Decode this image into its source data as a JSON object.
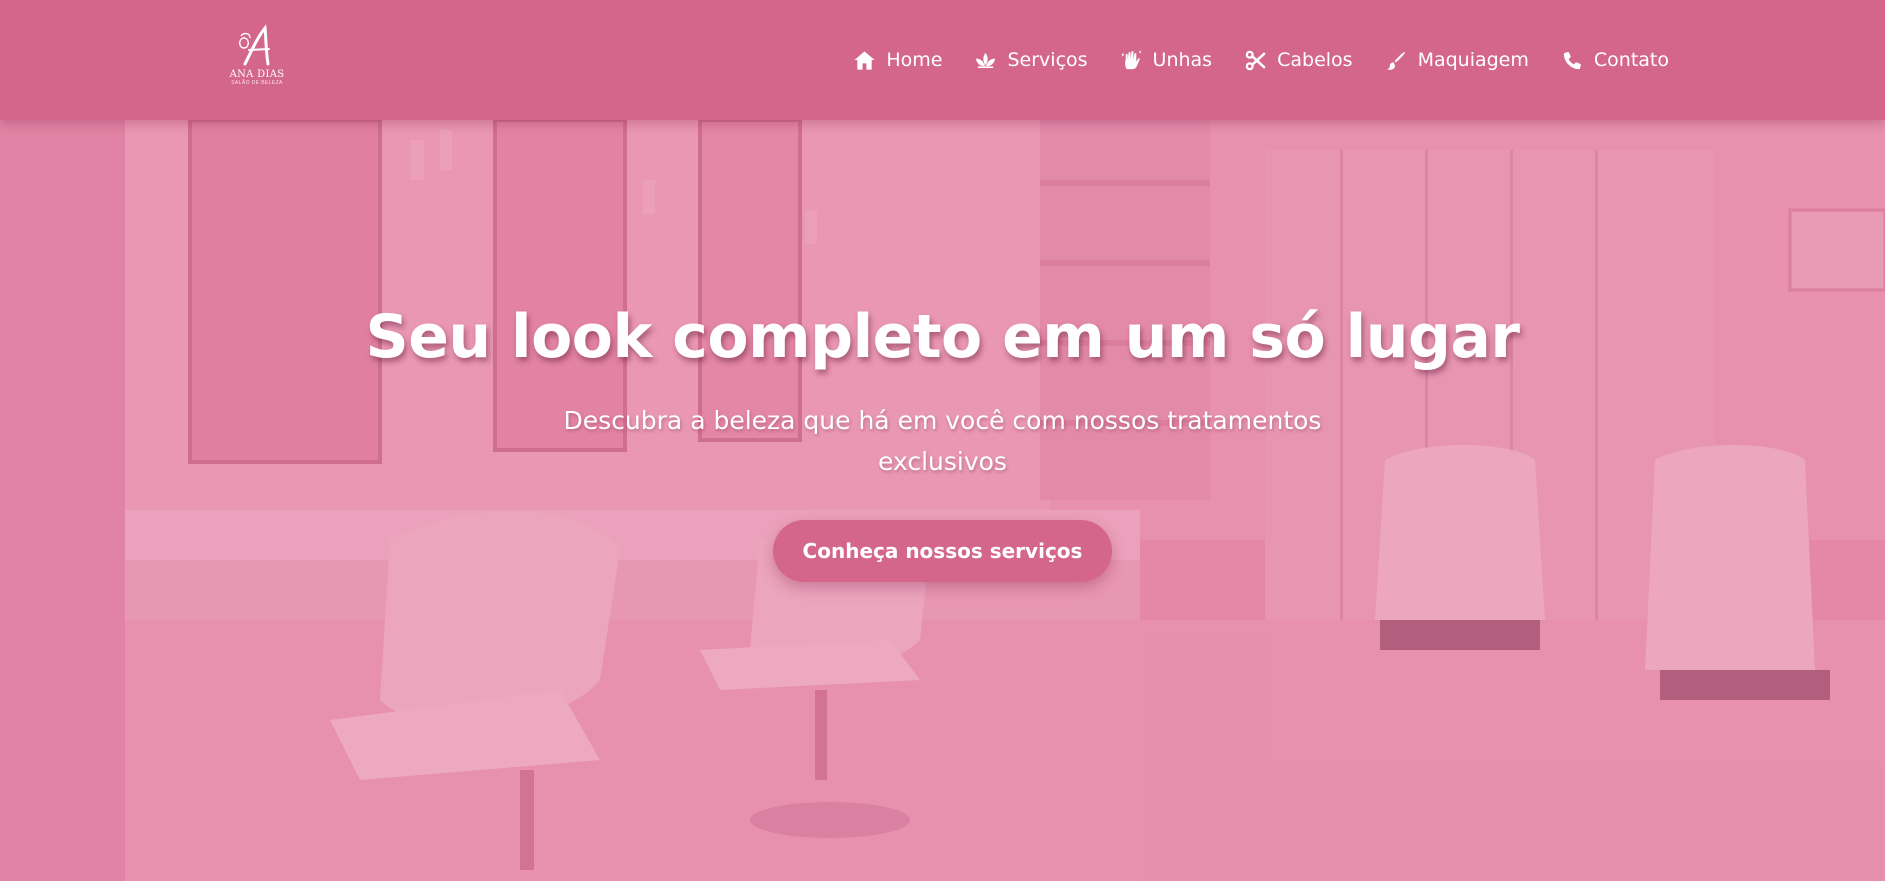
{
  "brand": {
    "name": "ANA DIAS",
    "tagline": "SALÃO DE BELEZA",
    "logo_icon": "letter-a-portrait-logo"
  },
  "nav": {
    "items": [
      {
        "label": "Home",
        "icon": "home-icon"
      },
      {
        "label": "Serviços",
        "icon": "lotus-icon"
      },
      {
        "label": "Unhas",
        "icon": "hand-sparkles-icon"
      },
      {
        "label": "Cabelos",
        "icon": "scissors-icon"
      },
      {
        "label": "Maquiagem",
        "icon": "brush-icon"
      },
      {
        "label": "Contato",
        "icon": "phone-icon"
      }
    ]
  },
  "hero": {
    "title": "Seu look completo em um só lugar",
    "subtitle": "Descubra a beleza que há em você com nossos tratamentos exclusivos",
    "cta_label": "Conheça nossos serviços",
    "background": "salon-interior-photo"
  },
  "colors": {
    "header_bg": "#d4668b",
    "accent": "#d4668b",
    "overlay": "#de6e96",
    "text": "#ffffff"
  }
}
